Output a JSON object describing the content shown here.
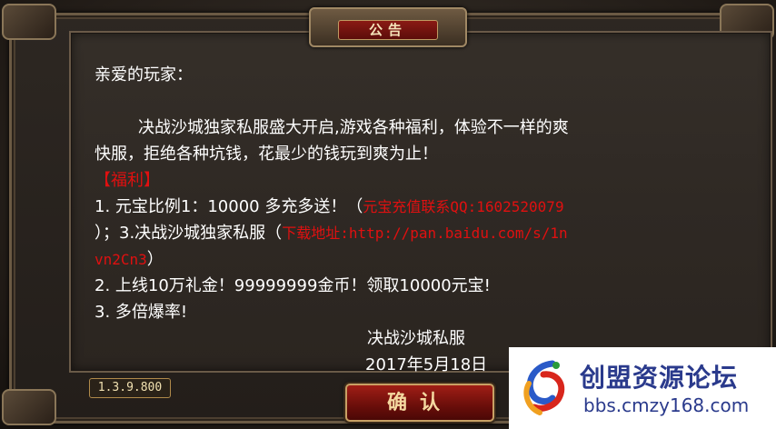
{
  "dialog": {
    "title": "公告",
    "greeting": "亲爱的玩家：",
    "intro_1": "决战沙城独家私服盛大开启,游戏各种福利，体验不一样的爽",
    "intro_2": "快服，拒绝各种坑钱，花最少的钱玩到爽为止！",
    "benefits_heading": "【福利】",
    "item1_prefix": "1. 元宝比例1：10000  多充多送！（",
    "item1_red": "元宝充值联系QQ:1602520079",
    "item1_cont_prefix": "）；3.决战沙城独家私服（",
    "item1_cont_red": "下载地址:http://pan.baidu.com/s/1n",
    "item1_cont2_red": "vn2Cn3",
    "item1_cont2_suffix": "）",
    "item2": "2. 上线10万礼金！99999999金币！领取10000元宝!",
    "item3": "3. 多倍爆率!",
    "signature": "决战沙城私服",
    "date": "2017年5月18日"
  },
  "version": "1.3.9.800",
  "confirm_label": "确认",
  "watermark": {
    "title": "创盟资源论坛",
    "url": "bbs.cmzy168.com"
  },
  "colors": {
    "text": "#ffffff",
    "highlight": "#e01010",
    "button": "#8a1a14"
  }
}
